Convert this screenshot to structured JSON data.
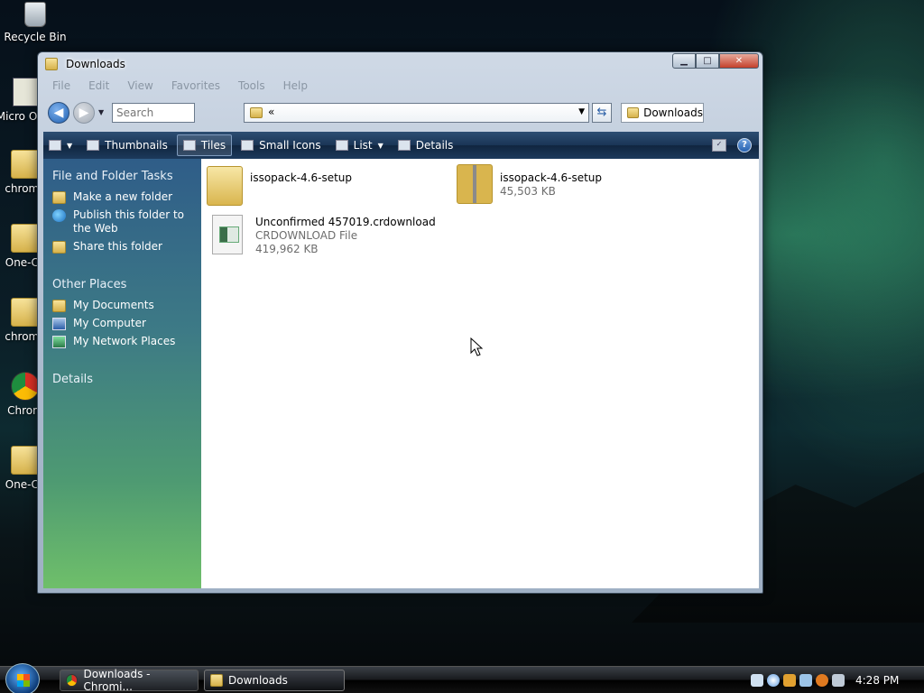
{
  "desktop": {
    "icons": [
      {
        "label": "Recycle Bin"
      },
      {
        "label": "Micro Outlo"
      },
      {
        "label": "chrome"
      },
      {
        "label": "One-Co"
      },
      {
        "label": "chrome"
      },
      {
        "label": "Chrom"
      },
      {
        "label": "One-Co"
      }
    ]
  },
  "window": {
    "title": "Downloads",
    "menu": [
      "File",
      "Edit",
      "View",
      "Favorites",
      "Tools",
      "Help"
    ],
    "search_placeholder": "Search",
    "address_text": "«",
    "breadcrumb": "Downloads",
    "toolbar": {
      "views": [
        "Thumbnails",
        "Tiles",
        "Small Icons",
        "List",
        "Details"
      ],
      "active_view": "Tiles"
    },
    "left_pane": {
      "tasks_header": "File and Folder Tasks",
      "tasks": [
        "Make a new folder",
        "Publish this folder to the Web",
        "Share this folder"
      ],
      "places_header": "Other Places",
      "places": [
        "My Documents",
        "My Computer",
        "My Network Places"
      ],
      "details_header": "Details"
    },
    "files": [
      {
        "name": "issopack-4.6-setup",
        "type": "folder"
      },
      {
        "name": "issopack-4.6-setup",
        "size": "45,503 KB",
        "type": "zip"
      },
      {
        "name": "Unconfirmed 457019.crdownload",
        "kind": "CRDOWNLOAD File",
        "size": "419,962 KB",
        "type": "file"
      }
    ]
  },
  "taskbar": {
    "tasks": [
      {
        "label": "Downloads - Chromi..."
      },
      {
        "label": "Downloads"
      }
    ],
    "clock": "4:28 PM"
  }
}
